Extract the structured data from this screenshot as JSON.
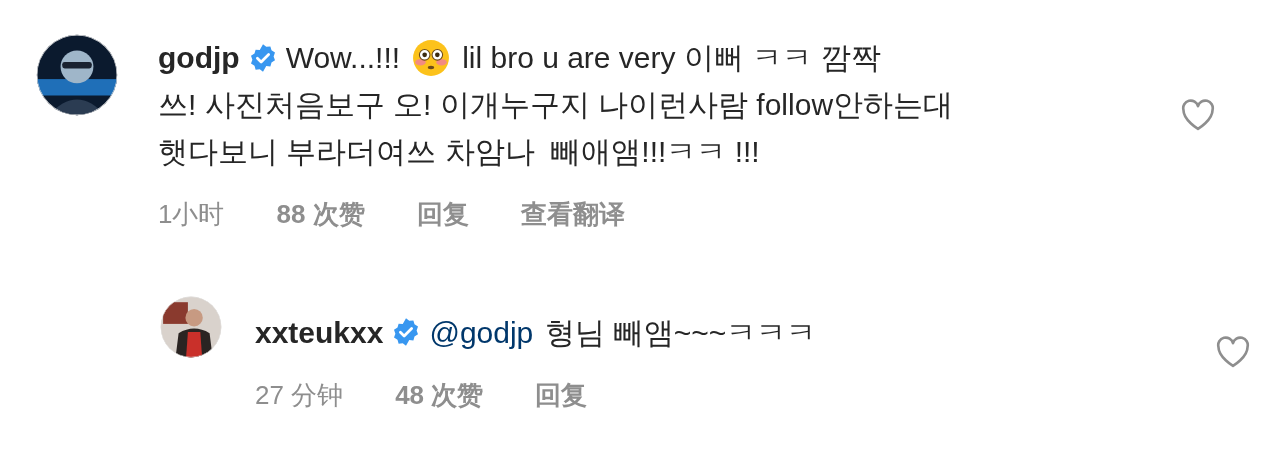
{
  "comments": [
    {
      "username": "godjp",
      "verified": true,
      "liked": false,
      "avatar": {
        "kind": "picture"
      },
      "lines": [
        [
          {
            "kind": "text",
            "text": "Wow...!!!"
          },
          {
            "kind": "emoji"
          },
          {
            "kind": "text",
            "text": "lil bro u are very 이뻐 ㅋㅋ 깜짝"
          }
        ],
        [
          {
            "kind": "text",
            "text": "쓰! 사진처음보구 오! 이개누구지 나이런사람 follow안하는대"
          }
        ],
        [
          {
            "kind": "text",
            "text": "햇다보니 부라더여쓰 차암나  빼애앰!!!ㅋㅋ !!!"
          }
        ]
      ],
      "time": "1小时",
      "likes": "88 次赞",
      "actions": [
        "回复",
        "查看翻译"
      ],
      "replies": [
        {
          "username": "xxteukxx",
          "verified": true,
          "liked": false,
          "avatar": {
            "kind": "picture"
          },
          "lines": [
            [
              {
                "kind": "mention",
                "text": "@godjp"
              },
              {
                "kind": "text",
                "text": "형님 빼앰~~~ㅋㅋㅋ"
              }
            ]
          ],
          "time": "27 分钟",
          "likes": "48 次赞",
          "actions": [
            "回复"
          ]
        }
      ]
    }
  ]
}
